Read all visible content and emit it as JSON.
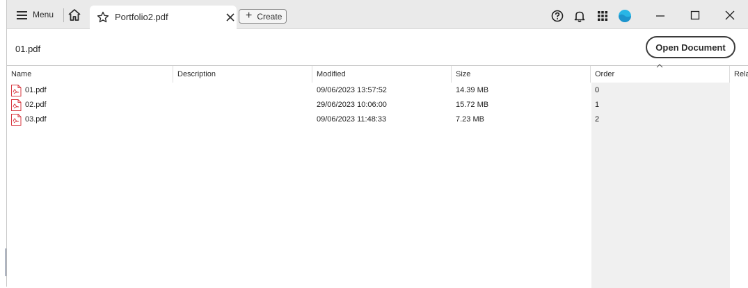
{
  "titlebar": {
    "menu_label": "Menu",
    "tab_title": "Portfolio2.pdf",
    "create_label": "Create"
  },
  "header": {
    "file_title": "01.pdf",
    "open_document_label": "Open Document"
  },
  "table": {
    "columns": [
      "Name",
      "Description",
      "Modified",
      "Size",
      "Order",
      "Rela"
    ],
    "rows": [
      {
        "name": "01.pdf",
        "description": "",
        "modified": "09/06/2023 13:57:52",
        "size": "14.39 MB",
        "order": "0"
      },
      {
        "name": "02.pdf",
        "description": "",
        "modified": "29/06/2023 10:06:00",
        "size": "15.72 MB",
        "order": "1"
      },
      {
        "name": "03.pdf",
        "description": "",
        "modified": "09/06/2023 11:48:33",
        "size": "7.23 MB",
        "order": "2"
      }
    ]
  },
  "colors": {
    "accent_avatar": "#29b6e6",
    "pdf_red": "#d7373f",
    "titlebar_bg": "#eaeaea",
    "sorted_column_bg": "#f0f0f0"
  },
  "icons": {
    "menu": "hamburger-icon",
    "home": "home-icon",
    "favorite": "star-icon",
    "close_tab": "close-icon",
    "create": "plus-icon",
    "help": "help-icon",
    "notifications": "bell-icon",
    "apps": "apps-grid-icon",
    "profile": "avatar",
    "file": "pdf-file-icon"
  }
}
